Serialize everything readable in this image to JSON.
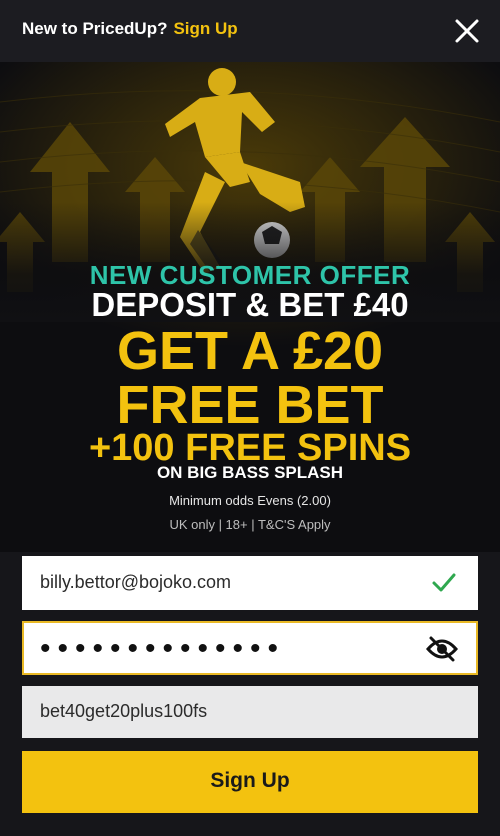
{
  "header": {
    "prompt_text": "New to PricedUp?",
    "signup_link": "Sign Up"
  },
  "offer": {
    "kicker": "NEW CUSTOMER OFFER",
    "deposit": "DEPOSIT & BET £40",
    "line1": "GET A £20",
    "line2": "FREE BET",
    "line3": "+100 FREE SPINS",
    "line4": "ON BIG BASS SPLASH",
    "min_odds": "Minimum odds Evens (2.00)",
    "terms": "UK only | 18+ | T&C'S Apply"
  },
  "form": {
    "email_value": "billy.bettor@bojoko.com",
    "password_mask": "••••••••••••••",
    "promo_value": "bet40get20plus100fs",
    "submit_label": "Sign Up"
  },
  "colors": {
    "accent": "#f3c20f",
    "teal": "#2ec4a9",
    "valid": "#2fa84f",
    "background": "#16161a"
  },
  "icons": {
    "close": "close-icon",
    "email_status": "check-icon",
    "password_toggle": "eye-slash-icon",
    "hero": "football-player-illustration"
  }
}
